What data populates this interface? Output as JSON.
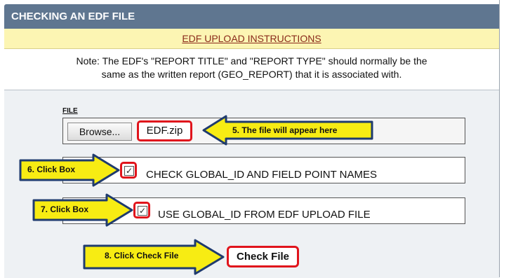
{
  "header": {
    "title": "CHECKING AN  EDF FILE"
  },
  "instructions_link": "EDF UPLOAD INSTRUCTIONS",
  "note": {
    "line1": "Note: The EDF's \"REPORT TITLE\" and \"REPORT TYPE\" should normally be the",
    "line2": "same as the written report (GEO_REPORT) that it is associated with."
  },
  "file": {
    "label": "FILE",
    "browse_label": "Browse...",
    "filename": "EDF.zip"
  },
  "options": [
    {
      "label": "CHECK GLOBAL_ID AND FIELD POINT NAMES",
      "checked": true
    },
    {
      "label": "USE GLOBAL_ID FROM EDF UPLOAD FILE",
      "checked": true
    }
  ],
  "check_button_label": "Check File",
  "callouts": {
    "file_appears": "5. The file will appear here",
    "click_box_1": "6. Click Box",
    "click_box_2": "7. Click Box",
    "click_check": "8. Click Check File"
  },
  "colors": {
    "header_bg": "#5f7690",
    "instructions_bg": "#fcf5b3",
    "highlight_red": "#e0141c",
    "callout_yellow": "#f7ec13",
    "callout_border": "#1f3b6e"
  },
  "icons": {
    "checkbox": "check-icon"
  }
}
